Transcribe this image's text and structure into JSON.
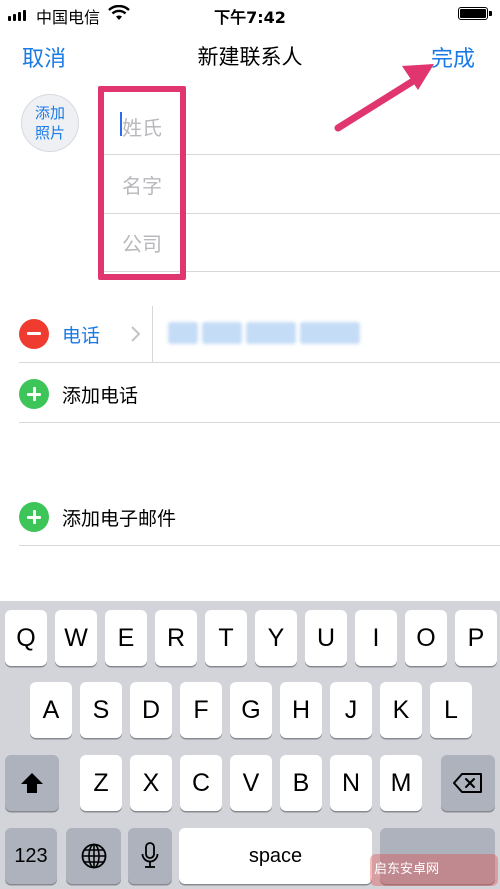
{
  "status_bar": {
    "carrier": "中国电信",
    "time": "下午7:42"
  },
  "nav": {
    "cancel_label": "取消",
    "title": "新建联系人",
    "done_label": "完成"
  },
  "photo": {
    "line1": "添加",
    "line2": "照片"
  },
  "fields": {
    "last_name_placeholder": "姓氏",
    "first_name_placeholder": "名字",
    "company_placeholder": "公司"
  },
  "phone_row": {
    "label": "电话"
  },
  "add_phone_label": "添加电话",
  "add_email_label": "添加电子邮件",
  "keyboard": {
    "row1": [
      "Q",
      "W",
      "E",
      "R",
      "T",
      "Y",
      "U",
      "I",
      "O",
      "P"
    ],
    "row2": [
      "A",
      "S",
      "D",
      "F",
      "G",
      "H",
      "J",
      "K",
      "L"
    ],
    "row3": [
      "Z",
      "X",
      "C",
      "V",
      "B",
      "N",
      "M"
    ],
    "numbers_key": "123",
    "space_key": "space"
  },
  "watermark": "启东安卓网",
  "colors": {
    "accent": "#1b7be6",
    "highlight": "#e0356e",
    "delete": "#f03b30",
    "add": "#3dc55a"
  }
}
